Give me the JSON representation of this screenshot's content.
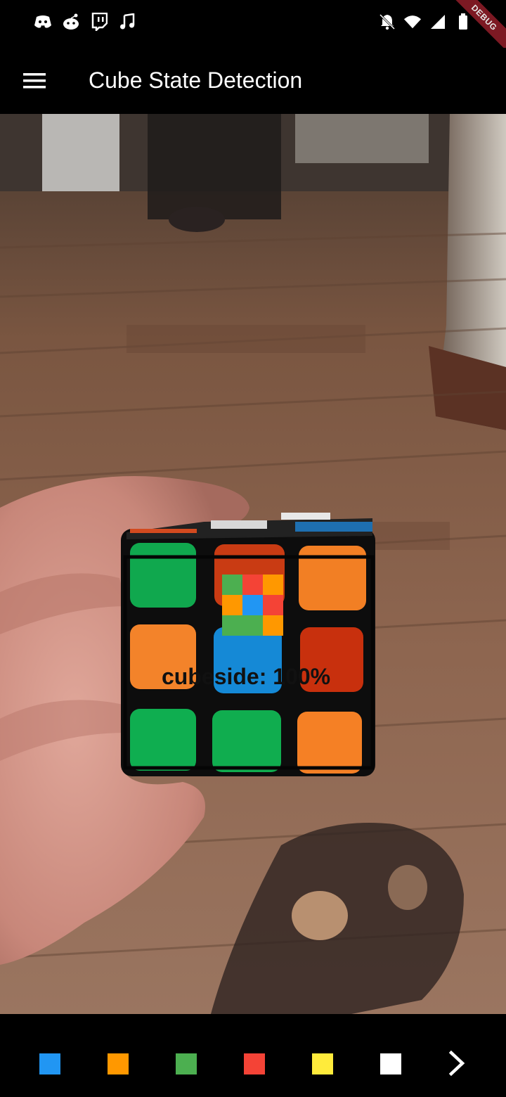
{
  "status_bar": {
    "left_icons": [
      "discord-icon",
      "reddit-icon",
      "twitch-icon",
      "music-note-icon"
    ],
    "right_icons": [
      "bell-off-icon",
      "wifi-icon",
      "signal-icon",
      "battery-icon"
    ],
    "debug_banner": "DEBUG"
  },
  "app_bar": {
    "menu_icon": "menu-icon",
    "title": "Cube State Detection"
  },
  "detection": {
    "label": "cubeside: 100%",
    "preview_grid": [
      "#4caf50",
      "#f44336",
      "#ff9800",
      "#ff9800",
      "#2196f3",
      "#f44336",
      "#4caf50",
      "#4caf50",
      "#ff9800"
    ]
  },
  "bottom_bar": {
    "swatches": [
      {
        "name": "blue",
        "color": "#2196f3"
      },
      {
        "name": "orange",
        "color": "#ff9800"
      },
      {
        "name": "green",
        "color": "#4caf50"
      },
      {
        "name": "red",
        "color": "#f44336"
      },
      {
        "name": "yellow",
        "color": "#ffeb3b"
      },
      {
        "name": "white",
        "color": "#ffffff"
      }
    ],
    "next_icon": "chevron-right-icon"
  }
}
